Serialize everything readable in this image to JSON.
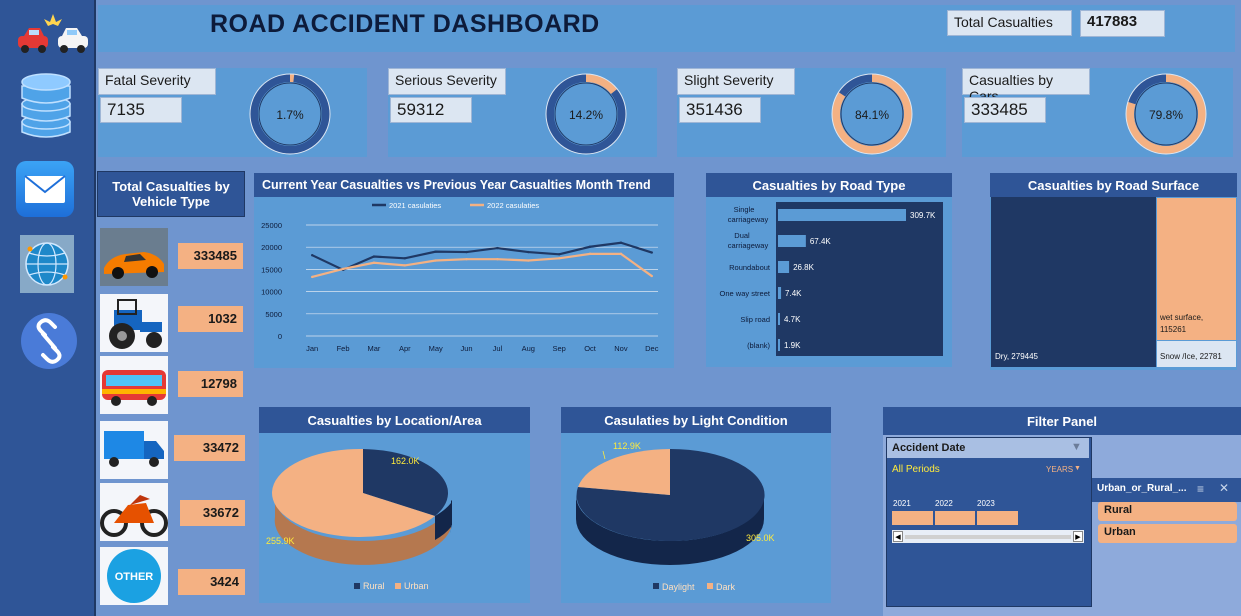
{
  "header": {
    "title": "ROAD ACCIDENT DASHBOARD",
    "total_label": "Total Casualties",
    "total_value": "417883"
  },
  "sidebar": [
    {
      "name": "car-crash-icon"
    },
    {
      "name": "database-icon"
    },
    {
      "name": "mail-icon"
    },
    {
      "name": "globe-icon"
    },
    {
      "name": "link-icon"
    }
  ],
  "kpis": [
    {
      "label": "Fatal Severity",
      "value": "7135",
      "pct": "1.7%",
      "fraction": 0.017
    },
    {
      "label": "Serious Severity",
      "value": "59312",
      "pct": "14.2%",
      "fraction": 0.142
    },
    {
      "label": "Slight Severity",
      "value": "351436",
      "pct": "84.1%",
      "fraction": 0.841
    },
    {
      "label": "Casualties by Cars",
      "value": "333485",
      "pct": "79.8%",
      "fraction": 0.798
    }
  ],
  "vehicle": {
    "title": "Total Casualties by Vehicle Type",
    "items": [
      {
        "icon": "car-icon",
        "value": "333485"
      },
      {
        "icon": "tractor-icon",
        "value": "1032"
      },
      {
        "icon": "bus-icon",
        "value": "12798"
      },
      {
        "icon": "truck-icon",
        "value": "33472"
      },
      {
        "icon": "motorcycle-icon",
        "value": "33672"
      },
      {
        "icon": "other-icon",
        "value": "3424",
        "label": "OTHER"
      }
    ]
  },
  "trend": {
    "title": "Current Year  Casualties vs Previous Year  Casualties Month Trend"
  },
  "road_type": {
    "title": "Casualties by Road Type"
  },
  "road_surface": {
    "title": "Casualties by Road Surface",
    "wet": "wet surface,",
    "wet_value": "115261",
    "dry": "Dry, 279445",
    "snow": "Snow /Ice, 22781"
  },
  "location": {
    "title": "Casualties by Location/Area",
    "rural_value": "162.0K",
    "urban_value": "255.9K",
    "legend_rural": "Rural",
    "legend_urban": "Urban"
  },
  "light": {
    "title": "Casulaties by Light Condition",
    "dark_value": "112.9K",
    "day_value": "305.0K",
    "legend_day": "Daylight",
    "legend_dark": "Dark"
  },
  "filter": {
    "title": "Filter Panel",
    "date_label": "Accident Date",
    "periods": "All Periods",
    "unit": "YEARS",
    "years": [
      "2021",
      "2022",
      "2023"
    ],
    "area_label": "Urban_or_Rural_...",
    "options": [
      "Rural",
      "Urban"
    ]
  },
  "chart_data": [
    {
      "type": "line",
      "title": "Current Year  Casualties vs Previous Year  Casualties Month Trend",
      "categories": [
        "Jan",
        "Feb",
        "Mar",
        "Apr",
        "May",
        "Jun",
        "Jul",
        "Aug",
        "Sep",
        "Oct",
        "Nov",
        "Dec"
      ],
      "series": [
        {
          "name": "2021 casulaties",
          "color": "#1f3864",
          "values": [
            18200,
            14900,
            17900,
            17500,
            19000,
            18900,
            19800,
            18900,
            18400,
            20100,
            21000,
            18800
          ]
        },
        {
          "name": "2022 casulaties",
          "color": "#f4b183",
          "values": [
            13300,
            15100,
            16500,
            15900,
            17000,
            17300,
            17300,
            17000,
            17500,
            18500,
            18500,
            13500
          ]
        }
      ],
      "yticks": [
        "25000",
        "20000",
        "15000",
        "10000",
        "5000",
        "0"
      ],
      "ylim": [
        0,
        25000
      ],
      "grid": true,
      "legend": "top"
    },
    {
      "type": "bar",
      "title": "Casualties by Road Type",
      "categories": [
        "Single carriageway",
        "Dual carriageway",
        "Roundabout",
        "One way street",
        "Slip road",
        "(blank)"
      ],
      "values": [
        309.7,
        67.4,
        26.8,
        7.4,
        4.7,
        1.9
      ],
      "labels": [
        "309.7K",
        "67.4K",
        "26.8K",
        "7.4K",
        "4.7K",
        "1.9K"
      ],
      "unit": "K"
    },
    {
      "type": "heatmap",
      "title": "Casualties by Road Surface",
      "categories": [
        "Dry",
        "wet surface",
        "Snow /Ice"
      ],
      "values": [
        279445,
        115261,
        22781
      ]
    },
    {
      "type": "pie",
      "title": "Casualties by Location/Area",
      "categories": [
        "Rural",
        "Urban"
      ],
      "values": [
        162.0,
        255.9
      ],
      "labels": [
        "162.0K",
        "255.9K"
      ],
      "colors": [
        "#1f3864",
        "#f4b183"
      ]
    },
    {
      "type": "pie",
      "title": "Casulaties by Light Condition",
      "categories": [
        "Daylight",
        "Dark"
      ],
      "values": [
        305.0,
        112.9
      ],
      "labels": [
        "305.0K",
        "112.9K"
      ],
      "colors": [
        "#1f3864",
        "#f4b183"
      ]
    }
  ]
}
